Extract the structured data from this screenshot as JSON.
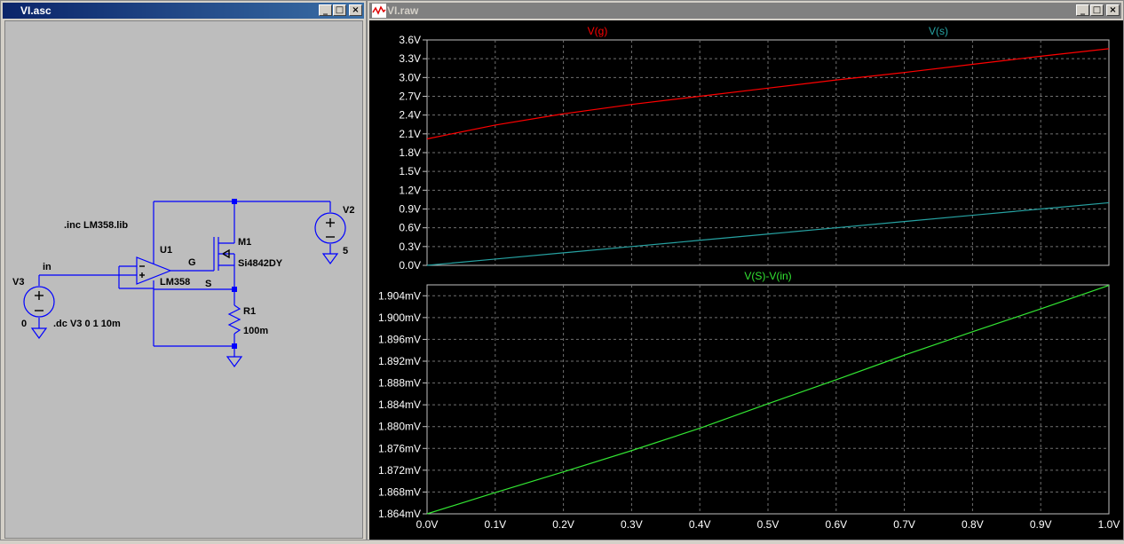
{
  "schematic_window": {
    "title": "VI.asc",
    "labels": {
      "inc": ".inc LM358.lib",
      "u1": "U1",
      "u1_model": "LM358",
      "in": "in",
      "v3": "V3",
      "v3_value": "0",
      "dc": ".dc V3 0 1 10m",
      "g": "G",
      "s": "S",
      "m1": "M1",
      "m1_model": "Si4842DY",
      "v2": "V2",
      "v2_value": "5",
      "r1": "R1",
      "r1_value": "100m"
    }
  },
  "plot_window": {
    "title": "VI.raw",
    "buttons": {
      "min": "_",
      "max": "□",
      "close": "×"
    }
  },
  "colors": {
    "wire": "#0000ff",
    "junction": "#0000ff",
    "vg": "#ff0000",
    "vs": "#26a2a2",
    "diff": "#33e633",
    "grid": "#707070",
    "axis_text": "#ffffff"
  },
  "chart_data": [
    {
      "type": "line",
      "title": "",
      "x": [
        0.0,
        0.1,
        0.2,
        0.3,
        0.4,
        0.5,
        0.6,
        0.7,
        0.8,
        0.9,
        1.0
      ],
      "series": [
        {
          "name": "V(g)",
          "values": [
            2.02,
            2.24,
            2.42,
            2.57,
            2.7,
            2.83,
            2.96,
            3.08,
            3.21,
            3.34,
            3.46
          ]
        },
        {
          "name": "V(s)",
          "values": [
            0.0,
            0.1,
            0.2,
            0.3,
            0.4,
            0.5,
            0.6,
            0.7,
            0.8,
            0.9,
            1.0
          ]
        }
      ],
      "xticks": [
        "0.0V",
        "0.1V",
        "0.2V",
        "0.3V",
        "0.4V",
        "0.5V",
        "0.6V",
        "0.7V",
        "0.8V",
        "0.9V",
        "1.0V"
      ],
      "yticks": [
        "0.0V",
        "0.3V",
        "0.6V",
        "0.9V",
        "1.2V",
        "1.5V",
        "1.8V",
        "2.1V",
        "2.4V",
        "2.7V",
        "3.0V",
        "3.3V",
        "3.6V"
      ],
      "xlim": [
        0,
        1
      ],
      "ylim": [
        0,
        3.6
      ],
      "grid": true
    },
    {
      "type": "line",
      "title": "",
      "x": [
        0.0,
        0.1,
        0.2,
        0.3,
        0.4,
        0.5,
        0.6,
        0.7,
        0.8,
        0.9,
        1.0
      ],
      "series": [
        {
          "name": "V(S)-V(in)",
          "values": [
            1.864,
            1.8679,
            1.8717,
            1.8756,
            1.8797,
            1.8842,
            1.8886,
            1.8931,
            1.8974,
            1.9016,
            1.9059
          ]
        }
      ],
      "xticks": [
        "0.0V",
        "0.1V",
        "0.2V",
        "0.3V",
        "0.4V",
        "0.5V",
        "0.6V",
        "0.7V",
        "0.8V",
        "0.9V",
        "1.0V"
      ],
      "yticks": [
        "1.864mV",
        "1.868mV",
        "1.872mV",
        "1.876mV",
        "1.880mV",
        "1.884mV",
        "1.888mV",
        "1.892mV",
        "1.896mV",
        "1.900mV",
        "1.904mV"
      ],
      "xlim": [
        0,
        1
      ],
      "ylim": [
        1.864,
        1.906
      ],
      "grid": true
    }
  ]
}
